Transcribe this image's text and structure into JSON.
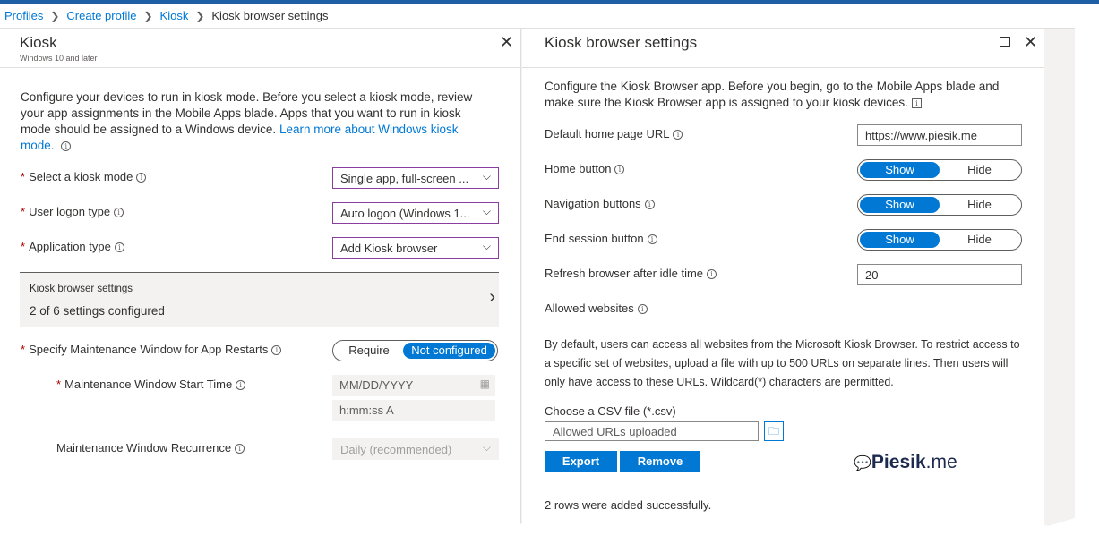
{
  "breadcrumb": {
    "items": [
      "Profiles",
      "Create profile",
      "Kiosk"
    ],
    "current": "Kiosk browser settings"
  },
  "kiosk_blade": {
    "title": "Kiosk",
    "subtitle": "Windows 10 and later",
    "description": "Configure your devices to run in kiosk mode. Before you select a kiosk mode, review your app assignments in the Mobile Apps blade. Apps that you want to run in kiosk mode should be assigned to a Windows device.",
    "learn_more": "Learn more about Windows kiosk mode.",
    "kiosk_mode": {
      "label": "Select a kiosk mode",
      "value": "Single app, full-screen ..."
    },
    "logon_type": {
      "label": "User logon type",
      "value": "Auto logon (Windows 1..."
    },
    "app_type": {
      "label": "Application type",
      "value": "Add Kiosk browser"
    },
    "kiosk_browser_settings": {
      "title": "Kiosk browser settings",
      "summary": "2 of 6 settings configured"
    },
    "maintenance_window": {
      "label": "Specify Maintenance Window for App Restarts",
      "options": [
        "Require",
        "Not configured"
      ],
      "selected": "Not configured"
    },
    "start_time": {
      "label": "Maintenance Window Start Time",
      "date_placeholder": "MM/DD/YYYY",
      "time_placeholder": "h:mm:ss A"
    },
    "recurrence": {
      "label": "Maintenance Window Recurrence",
      "value": "Daily (recommended)"
    }
  },
  "browser_blade": {
    "title": "Kiosk browser settings",
    "description": "Configure the Kiosk Browser app. Before you begin, go to the Mobile Apps blade and make sure the Kiosk Browser app is assigned to your kiosk devices.",
    "home_url": {
      "label": "Default home page URL",
      "value": "https://www.piesik.me"
    },
    "home_button": {
      "label": "Home button",
      "options": [
        "Show",
        "Hide"
      ],
      "selected": "Show"
    },
    "nav_buttons": {
      "label": "Navigation buttons",
      "options": [
        "Show",
        "Hide"
      ],
      "selected": "Show"
    },
    "end_session": {
      "label": "End session button",
      "options": [
        "Show",
        "Hide"
      ],
      "selected": "Show"
    },
    "refresh_idle": {
      "label": "Refresh browser after idle time",
      "value": "20"
    },
    "allowed_websites": {
      "label": "Allowed websites"
    },
    "paragraph": "By default, users can access all websites from the Microsoft Kiosk Browser. To restrict access to a specific set of websites, upload a file with up to 500 URLs on separate lines. Then users will only have access to these URLs. Wildcard(*) characters are permitted.",
    "csv": {
      "label": "Choose a CSV file (*.csv)",
      "placeholder": "Allowed URLs uploaded"
    },
    "export_label": "Export",
    "remove_label": "Remove",
    "status": "2 rows were added successfully.",
    "brand": {
      "name": "Piesik",
      "suffix": ".me"
    }
  }
}
